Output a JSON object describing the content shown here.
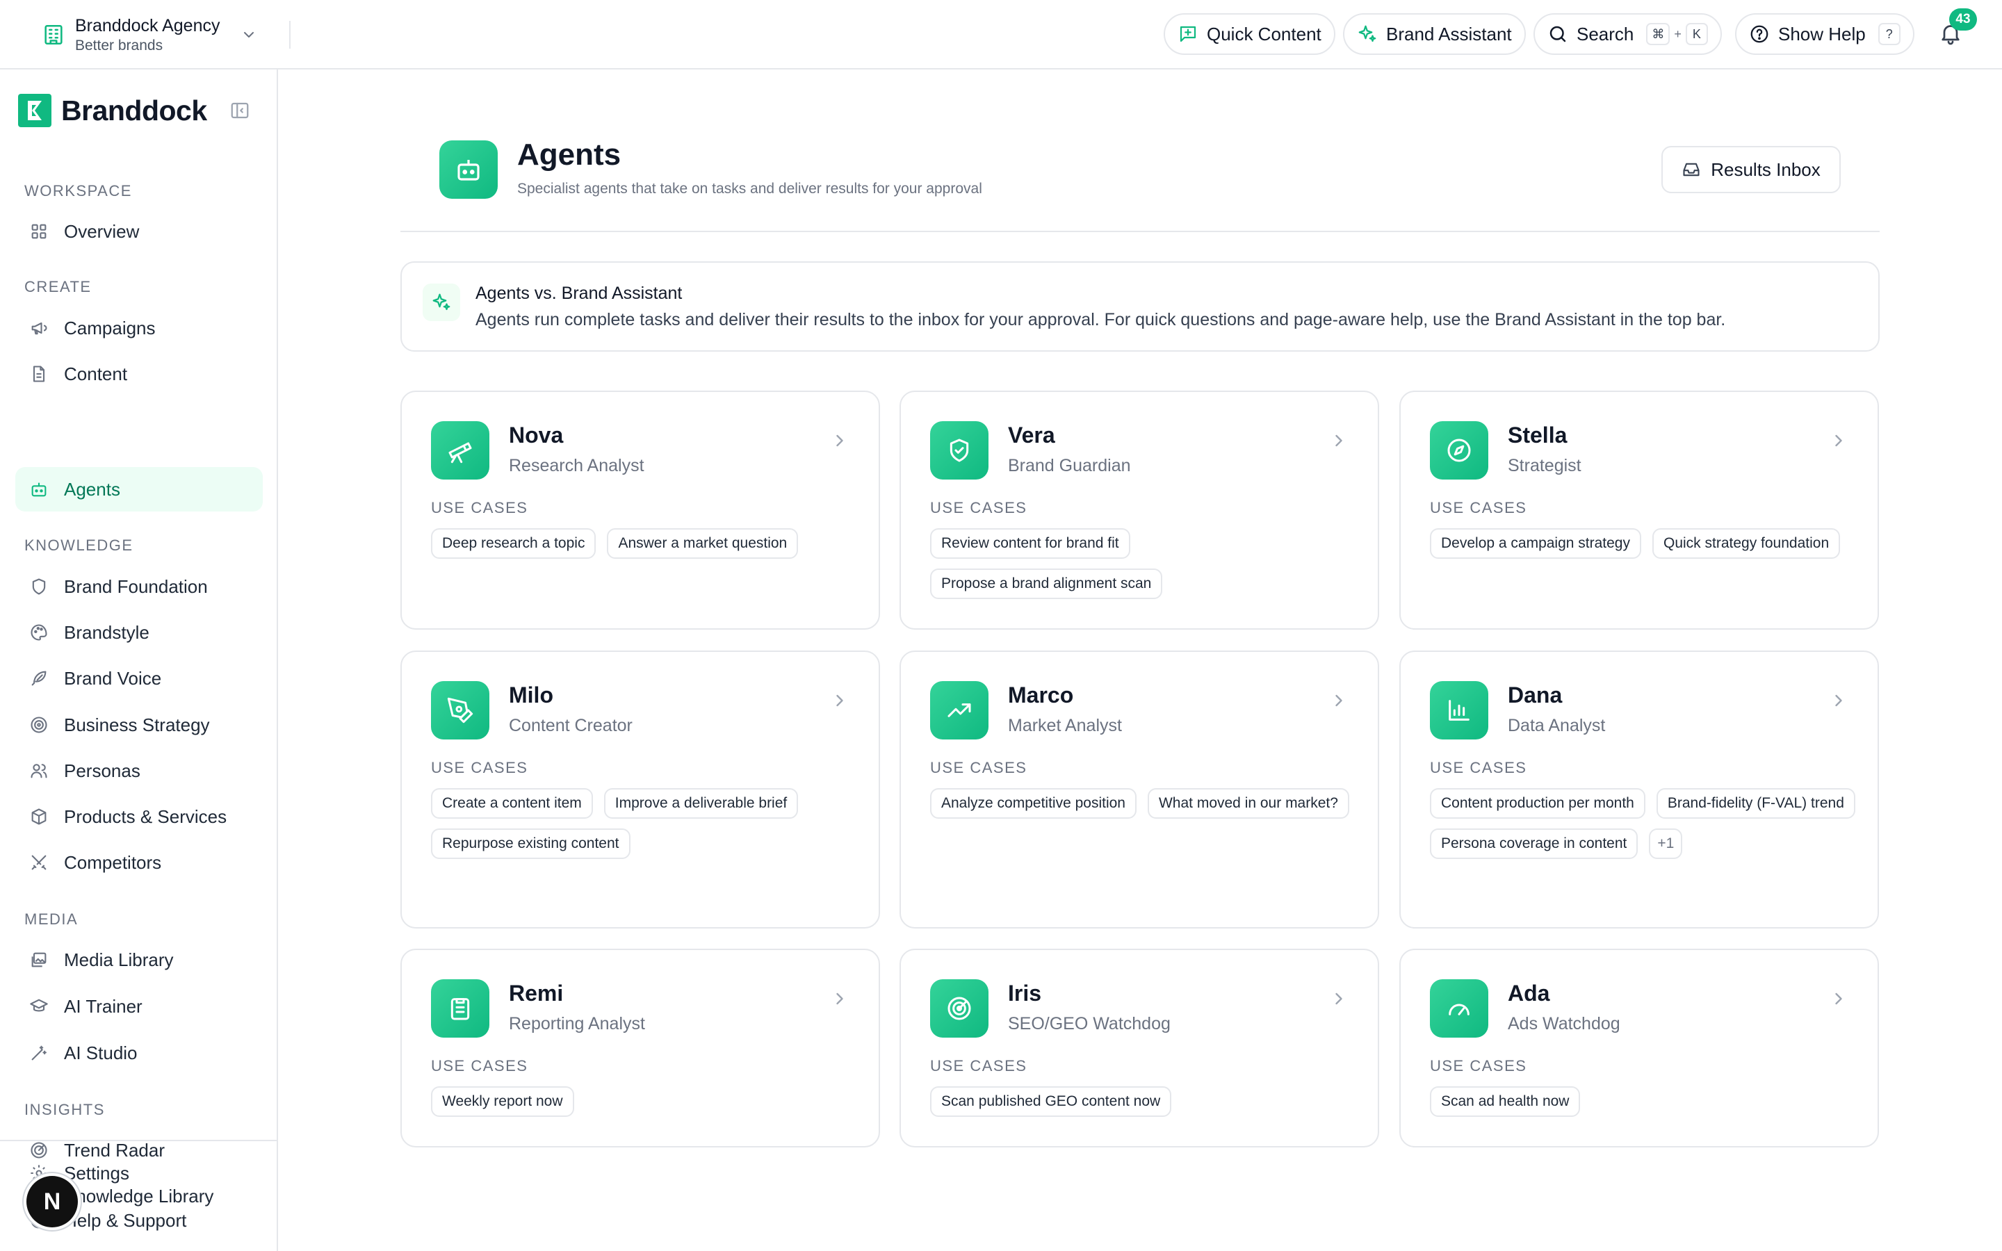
{
  "topbar": {
    "workspace_name": "Branddock Agency",
    "workspace_sub": "Better brands",
    "quick_content": "Quick Content",
    "brand_assistant": "Brand Assistant",
    "search": "Search",
    "search_kbd_1": "⌘",
    "search_kbd_plus": "+",
    "search_kbd_2": "K",
    "show_help": "Show Help",
    "help_kbd": "?",
    "notification_count": "43"
  },
  "sidebar": {
    "brand": "Branddock",
    "sections": {
      "workspace": "WORKSPACE",
      "create": "CREATE",
      "knowledge": "KNOWLEDGE",
      "media": "MEDIA",
      "insights": "INSIGHTS"
    },
    "items": {
      "overview": "Overview",
      "campaigns": "Campaigns",
      "content": "Content",
      "agents": "Agents",
      "brand_foundation": "Brand Foundation",
      "brandstyle": "Brandstyle",
      "brand_voice": "Brand Voice",
      "business_strategy": "Business Strategy",
      "personas": "Personas",
      "products_services": "Products & Services",
      "competitors": "Competitors",
      "media_library": "Media Library",
      "ai_trainer": "AI Trainer",
      "ai_studio": "AI Studio",
      "trend_radar": "Trend Radar",
      "knowledge_library": "Knowledge Library",
      "settings": "Settings",
      "help_support": "Help & Support"
    },
    "fab_label": "N"
  },
  "main": {
    "title": "Agents",
    "subtitle": "Specialist agents that take on tasks and deliver results for your approval",
    "results_inbox": "Results Inbox",
    "info": {
      "title": "Agents vs. Brand Assistant",
      "text": "Agents run complete tasks and deliver their results to the inbox for your approval. For quick questions and page-aware help, use the Brand Assistant in the top bar."
    },
    "use_cases_label": "USE CASES",
    "agents": [
      {
        "name": "Nova",
        "role": "Research Analyst",
        "icon": "telescope-icon",
        "use_cases": [
          "Deep research a topic",
          "Answer a market question"
        ]
      },
      {
        "name": "Vera",
        "role": "Brand Guardian",
        "icon": "shield-check-icon",
        "use_cases": [
          "Review content for brand fit",
          "Propose a brand alignment scan"
        ]
      },
      {
        "name": "Stella",
        "role": "Strategist",
        "icon": "compass-icon",
        "use_cases": [
          "Develop a campaign strategy",
          "Quick strategy foundation"
        ]
      },
      {
        "name": "Milo",
        "role": "Content Creator",
        "icon": "pen-tool-icon",
        "use_cases": [
          "Create a content item",
          "Improve a deliverable brief",
          "Repurpose existing content"
        ]
      },
      {
        "name": "Marco",
        "role": "Market Analyst",
        "icon": "trending-up-icon",
        "use_cases": [
          "Analyze competitive position",
          "What moved in our market?"
        ]
      },
      {
        "name": "Dana",
        "role": "Data Analyst",
        "icon": "bar-chart-icon",
        "use_cases": [
          "Content production per month",
          "Brand-fidelity (F-VAL) trend",
          "Persona coverage in content"
        ],
        "more": "+1"
      },
      {
        "name": "Remi",
        "role": "Reporting Analyst",
        "icon": "clipboard-list-icon",
        "use_cases": [
          "Weekly report now"
        ]
      },
      {
        "name": "Iris",
        "role": "SEO/GEO Watchdog",
        "icon": "radar-icon",
        "use_cases": [
          "Scan published GEO content now"
        ]
      },
      {
        "name": "Ada",
        "role": "Ads Watchdog",
        "icon": "gauge-icon",
        "use_cases": [
          "Scan ad health now"
        ]
      }
    ]
  },
  "colors": {
    "accent": "#10b981",
    "accent_light": "#ecfdf5",
    "border": "#e5e7eb",
    "text": "#111827",
    "muted": "#6b7280"
  }
}
